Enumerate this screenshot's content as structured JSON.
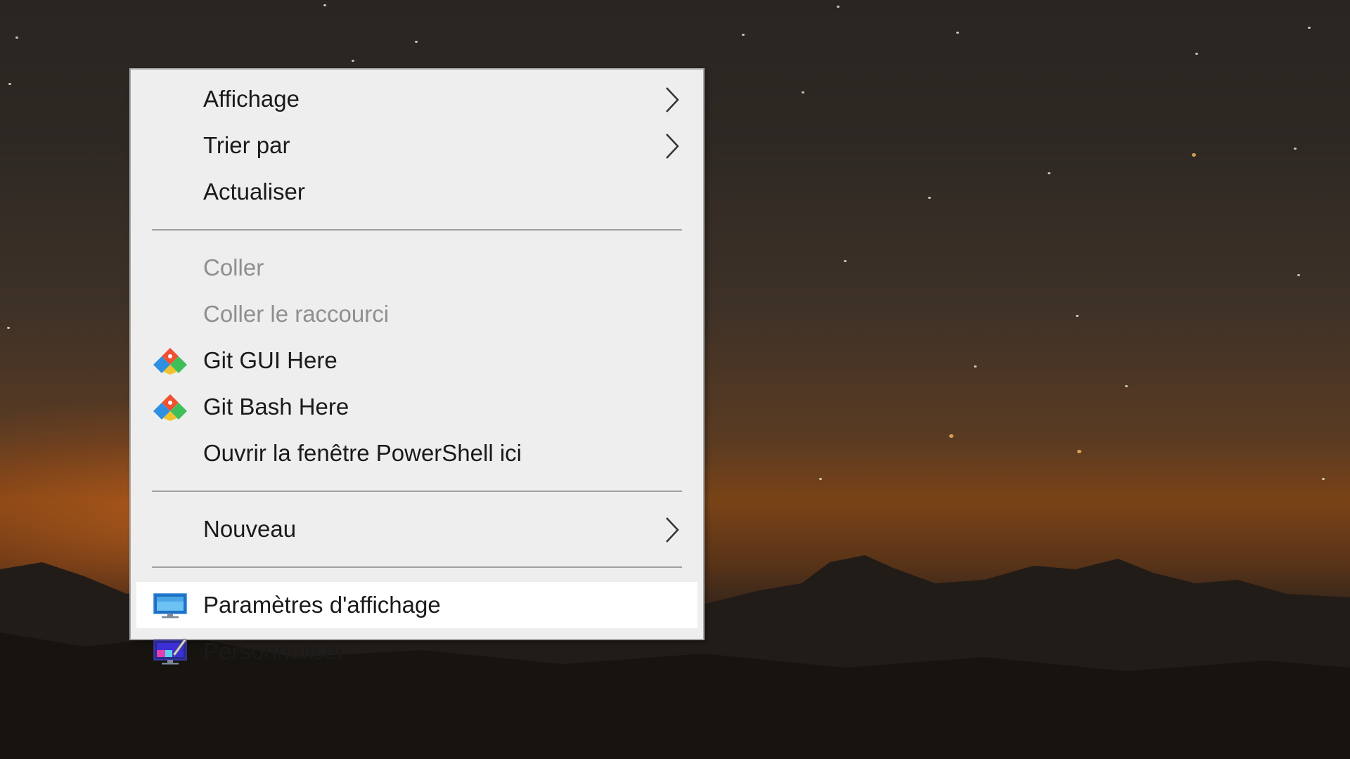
{
  "desktop": {
    "wallpaper": "night-sky-mountains",
    "colors": {
      "menu_background": "#eeeeee",
      "menu_border": "#a8a8a8",
      "highlight": "#ffffff",
      "text": "#1a1a1a",
      "disabled_text": "#8f8f8f",
      "separator": "#a0a0a0"
    }
  },
  "context_menu": {
    "groups": [
      {
        "items": [
          {
            "label": "Affichage",
            "icon": null,
            "submenu": true,
            "disabled": false
          },
          {
            "label": "Trier par",
            "icon": null,
            "submenu": true,
            "disabled": false
          },
          {
            "label": "Actualiser",
            "icon": null,
            "submenu": false,
            "disabled": false
          }
        ]
      },
      {
        "items": [
          {
            "label": "Coller",
            "icon": null,
            "submenu": false,
            "disabled": true
          },
          {
            "label": "Coller le raccourci",
            "icon": null,
            "submenu": false,
            "disabled": true
          },
          {
            "label": "Git GUI Here",
            "icon": "git-icon",
            "submenu": false,
            "disabled": false
          },
          {
            "label": "Git Bash Here",
            "icon": "git-icon",
            "submenu": false,
            "disabled": false
          },
          {
            "label": "Ouvrir la fenêtre PowerShell ici",
            "icon": null,
            "submenu": false,
            "disabled": false
          }
        ]
      },
      {
        "items": [
          {
            "label": "Nouveau",
            "icon": null,
            "submenu": true,
            "disabled": false
          }
        ]
      },
      {
        "items": [
          {
            "label": "Paramètres d'affichage",
            "icon": "display-settings-icon",
            "submenu": false,
            "disabled": false,
            "highlighted": true
          },
          {
            "label": "Personnaliser",
            "icon": "personalize-icon",
            "submenu": false,
            "disabled": false
          }
        ]
      }
    ]
  }
}
